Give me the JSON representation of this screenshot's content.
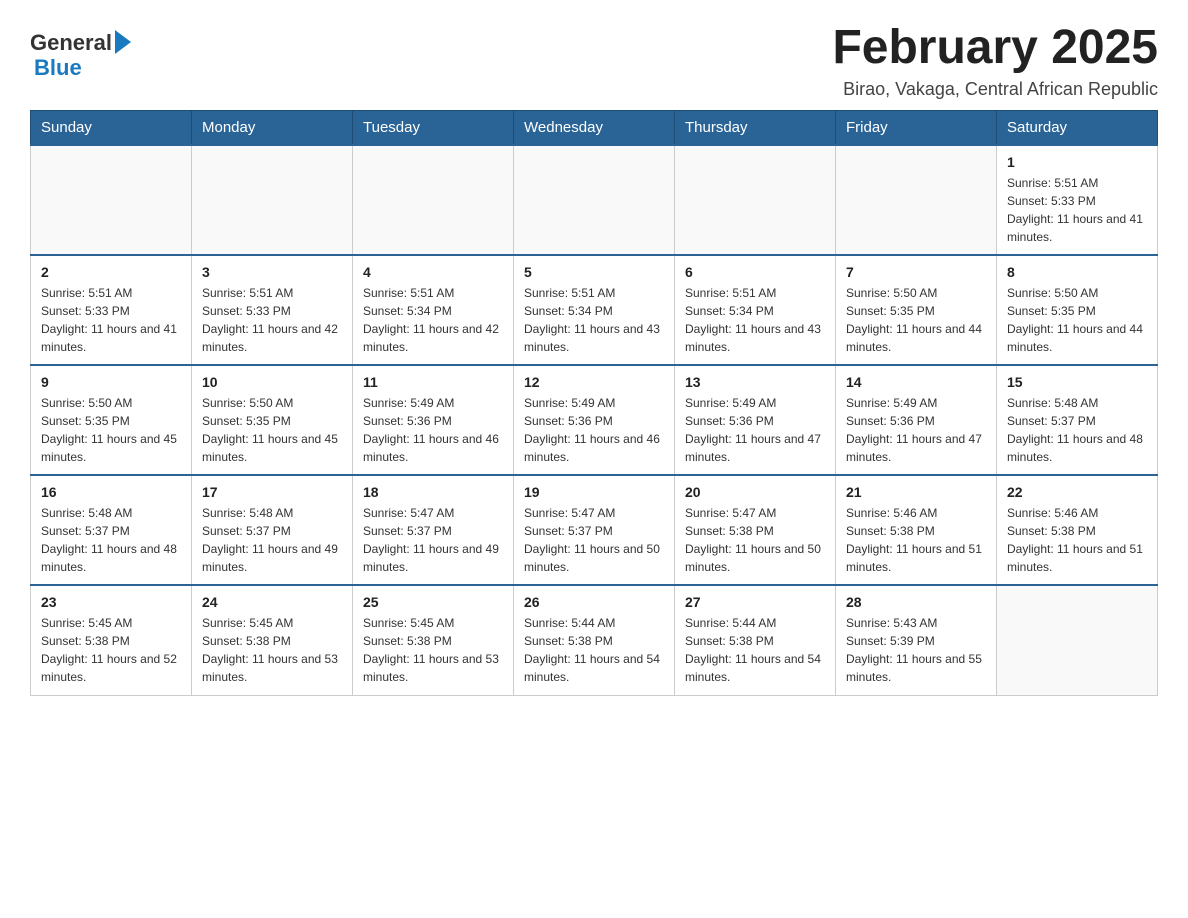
{
  "logo": {
    "general": "General",
    "blue": "Blue"
  },
  "header": {
    "title": "February 2025",
    "subtitle": "Birao, Vakaga, Central African Republic"
  },
  "days_of_week": [
    "Sunday",
    "Monday",
    "Tuesday",
    "Wednesday",
    "Thursday",
    "Friday",
    "Saturday"
  ],
  "weeks": [
    [
      {
        "day": "",
        "info": ""
      },
      {
        "day": "",
        "info": ""
      },
      {
        "day": "",
        "info": ""
      },
      {
        "day": "",
        "info": ""
      },
      {
        "day": "",
        "info": ""
      },
      {
        "day": "",
        "info": ""
      },
      {
        "day": "1",
        "info": "Sunrise: 5:51 AM\nSunset: 5:33 PM\nDaylight: 11 hours and 41 minutes."
      }
    ],
    [
      {
        "day": "2",
        "info": "Sunrise: 5:51 AM\nSunset: 5:33 PM\nDaylight: 11 hours and 41 minutes."
      },
      {
        "day": "3",
        "info": "Sunrise: 5:51 AM\nSunset: 5:33 PM\nDaylight: 11 hours and 42 minutes."
      },
      {
        "day": "4",
        "info": "Sunrise: 5:51 AM\nSunset: 5:34 PM\nDaylight: 11 hours and 42 minutes."
      },
      {
        "day": "5",
        "info": "Sunrise: 5:51 AM\nSunset: 5:34 PM\nDaylight: 11 hours and 43 minutes."
      },
      {
        "day": "6",
        "info": "Sunrise: 5:51 AM\nSunset: 5:34 PM\nDaylight: 11 hours and 43 minutes."
      },
      {
        "day": "7",
        "info": "Sunrise: 5:50 AM\nSunset: 5:35 PM\nDaylight: 11 hours and 44 minutes."
      },
      {
        "day": "8",
        "info": "Sunrise: 5:50 AM\nSunset: 5:35 PM\nDaylight: 11 hours and 44 minutes."
      }
    ],
    [
      {
        "day": "9",
        "info": "Sunrise: 5:50 AM\nSunset: 5:35 PM\nDaylight: 11 hours and 45 minutes."
      },
      {
        "day": "10",
        "info": "Sunrise: 5:50 AM\nSunset: 5:35 PM\nDaylight: 11 hours and 45 minutes."
      },
      {
        "day": "11",
        "info": "Sunrise: 5:49 AM\nSunset: 5:36 PM\nDaylight: 11 hours and 46 minutes."
      },
      {
        "day": "12",
        "info": "Sunrise: 5:49 AM\nSunset: 5:36 PM\nDaylight: 11 hours and 46 minutes."
      },
      {
        "day": "13",
        "info": "Sunrise: 5:49 AM\nSunset: 5:36 PM\nDaylight: 11 hours and 47 minutes."
      },
      {
        "day": "14",
        "info": "Sunrise: 5:49 AM\nSunset: 5:36 PM\nDaylight: 11 hours and 47 minutes."
      },
      {
        "day": "15",
        "info": "Sunrise: 5:48 AM\nSunset: 5:37 PM\nDaylight: 11 hours and 48 minutes."
      }
    ],
    [
      {
        "day": "16",
        "info": "Sunrise: 5:48 AM\nSunset: 5:37 PM\nDaylight: 11 hours and 48 minutes."
      },
      {
        "day": "17",
        "info": "Sunrise: 5:48 AM\nSunset: 5:37 PM\nDaylight: 11 hours and 49 minutes."
      },
      {
        "day": "18",
        "info": "Sunrise: 5:47 AM\nSunset: 5:37 PM\nDaylight: 11 hours and 49 minutes."
      },
      {
        "day": "19",
        "info": "Sunrise: 5:47 AM\nSunset: 5:37 PM\nDaylight: 11 hours and 50 minutes."
      },
      {
        "day": "20",
        "info": "Sunrise: 5:47 AM\nSunset: 5:38 PM\nDaylight: 11 hours and 50 minutes."
      },
      {
        "day": "21",
        "info": "Sunrise: 5:46 AM\nSunset: 5:38 PM\nDaylight: 11 hours and 51 minutes."
      },
      {
        "day": "22",
        "info": "Sunrise: 5:46 AM\nSunset: 5:38 PM\nDaylight: 11 hours and 51 minutes."
      }
    ],
    [
      {
        "day": "23",
        "info": "Sunrise: 5:45 AM\nSunset: 5:38 PM\nDaylight: 11 hours and 52 minutes."
      },
      {
        "day": "24",
        "info": "Sunrise: 5:45 AM\nSunset: 5:38 PM\nDaylight: 11 hours and 53 minutes."
      },
      {
        "day": "25",
        "info": "Sunrise: 5:45 AM\nSunset: 5:38 PM\nDaylight: 11 hours and 53 minutes."
      },
      {
        "day": "26",
        "info": "Sunrise: 5:44 AM\nSunset: 5:38 PM\nDaylight: 11 hours and 54 minutes."
      },
      {
        "day": "27",
        "info": "Sunrise: 5:44 AM\nSunset: 5:38 PM\nDaylight: 11 hours and 54 minutes."
      },
      {
        "day": "28",
        "info": "Sunrise: 5:43 AM\nSunset: 5:39 PM\nDaylight: 11 hours and 55 minutes."
      },
      {
        "day": "",
        "info": ""
      }
    ]
  ]
}
